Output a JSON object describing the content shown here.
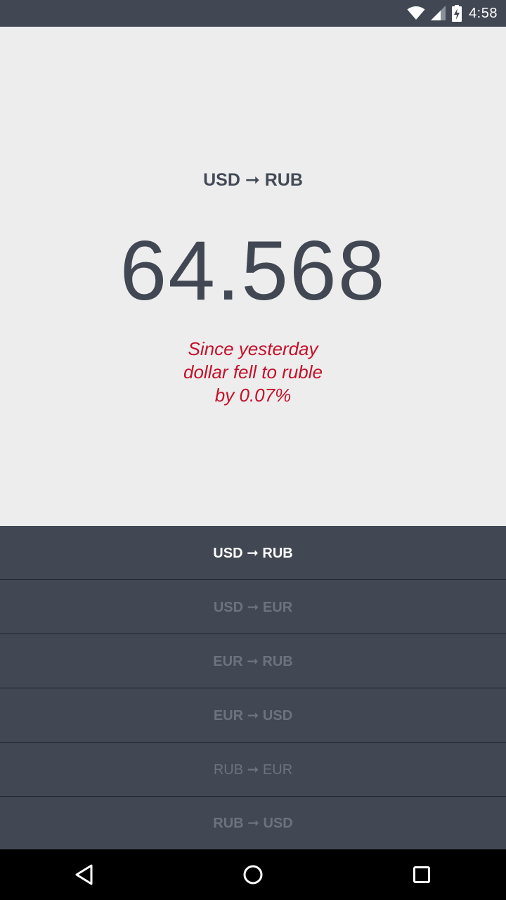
{
  "status_bar": {
    "time": "4:58",
    "icons": [
      "wifi-icon",
      "cell-signal-icon",
      "battery-charging-icon"
    ]
  },
  "rate": {
    "pair": "USD ➞ RUB",
    "value": "64.568",
    "change_lines": [
      "Since yesterday",
      "dollar fell to ruble",
      "by 0.07%"
    ],
    "change_color": "#c4112a"
  },
  "pairs": [
    {
      "label": "USD ➞ RUB",
      "selected": true
    },
    {
      "label": "USD ➞ EUR",
      "selected": false
    },
    {
      "label": "EUR ➞ RUB",
      "selected": false
    },
    {
      "label": "EUR ➞ USD",
      "selected": false
    },
    {
      "label": "RUB ➞ EUR",
      "selected": false
    },
    {
      "label": "RUB ➞ USD",
      "selected": false
    }
  ],
  "nav_bar": {
    "icons": [
      "back-icon",
      "home-icon",
      "recents-icon"
    ]
  },
  "colors": {
    "primary_dark": "#414853",
    "background": "#ededed",
    "accent_red": "#c4112a",
    "inactive_text": "#6b737e"
  }
}
